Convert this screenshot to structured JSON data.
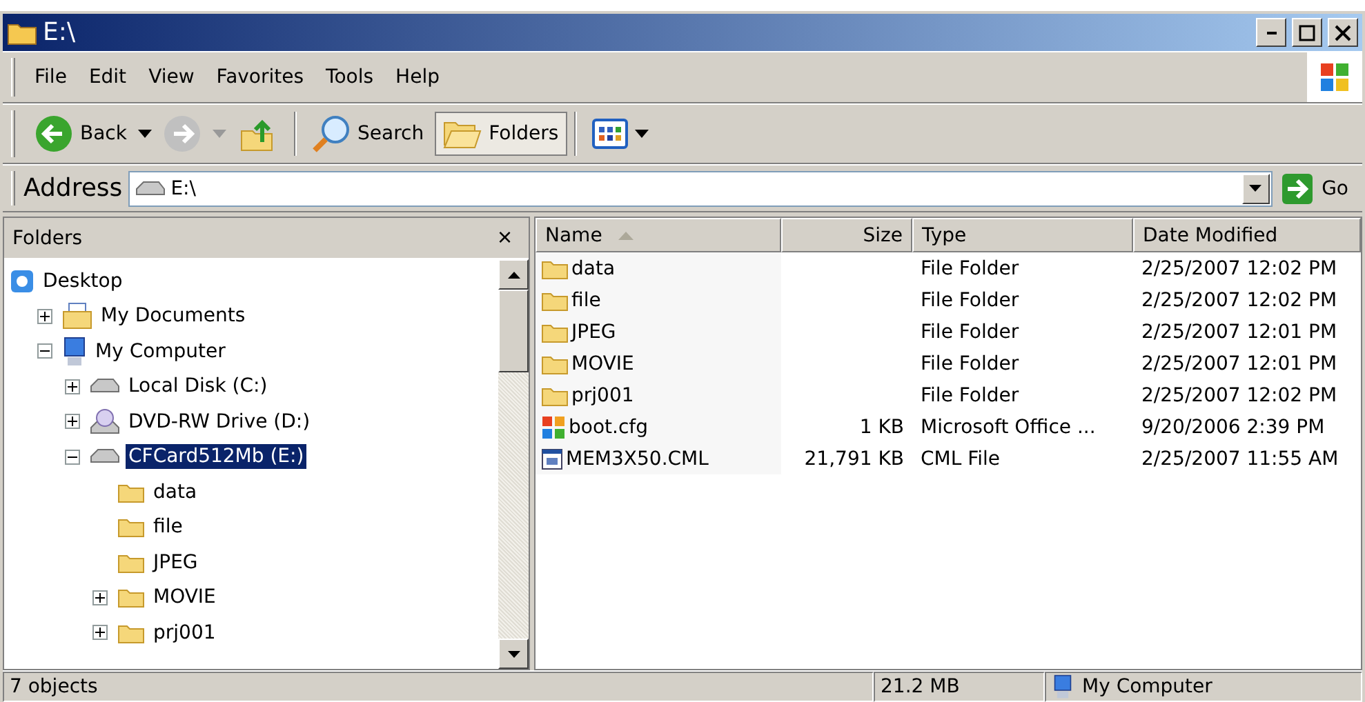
{
  "window": {
    "title": "E:\\"
  },
  "menu": [
    "File",
    "Edit",
    "View",
    "Favorites",
    "Tools",
    "Help"
  ],
  "toolbar": {
    "back": "Back",
    "search": "Search",
    "folders": "Folders",
    "folders_pressed": true
  },
  "address": {
    "label": "Address",
    "value": "E:\\",
    "go": "Go"
  },
  "folders_pane": {
    "title": "Folders",
    "close": "×",
    "tree": [
      {
        "label": "Desktop",
        "kind": "desktop",
        "selected": false,
        "children": [
          {
            "label": "My Documents",
            "kind": "documents",
            "expanded": false,
            "selected": false
          },
          {
            "label": "My Computer",
            "kind": "computer",
            "expanded": true,
            "selected": false,
            "children": [
              {
                "label": "Local Disk (C:)",
                "kind": "disk",
                "expanded": false,
                "selected": false
              },
              {
                "label": "DVD-RW Drive (D:)",
                "kind": "dvd",
                "expanded": false,
                "selected": false
              },
              {
                "label": "CFCard512Mb (E:)",
                "kind": "disk",
                "expanded": true,
                "selected": true,
                "children": [
                  {
                    "label": "data",
                    "kind": "folder",
                    "selected": false
                  },
                  {
                    "label": "file",
                    "kind": "folder",
                    "selected": false
                  },
                  {
                    "label": "JPEG",
                    "kind": "folder",
                    "selected": false
                  },
                  {
                    "label": "MOVIE",
                    "kind": "folder",
                    "expanded": false,
                    "selected": false
                  },
                  {
                    "label": "prj001",
                    "kind": "folder",
                    "expanded": false,
                    "selected": false
                  }
                ]
              }
            ]
          }
        ]
      }
    ]
  },
  "file_list": {
    "columns": [
      {
        "label": "Name",
        "sorted": true
      },
      {
        "label": "Size",
        "sorted": false
      },
      {
        "label": "Type",
        "sorted": false
      },
      {
        "label": "Date Modified",
        "sorted": false
      }
    ],
    "rows": [
      {
        "kind": "folder",
        "name": "data",
        "size": "",
        "type": "File Folder",
        "date": "2/25/2007 12:02 PM"
      },
      {
        "kind": "folder",
        "name": "file",
        "size": "",
        "type": "File Folder",
        "date": "2/25/2007 12:02 PM"
      },
      {
        "kind": "folder",
        "name": "JPEG",
        "size": "",
        "type": "File Folder",
        "date": "2/25/2007 12:01 PM"
      },
      {
        "kind": "folder",
        "name": "MOVIE",
        "size": "",
        "type": "File Folder",
        "date": "2/25/2007 12:01 PM"
      },
      {
        "kind": "folder",
        "name": "prj001",
        "size": "",
        "type": "File Folder",
        "date": "2/25/2007 12:02 PM"
      },
      {
        "kind": "office",
        "name": "boot.cfg",
        "size": "1 KB",
        "type": "Microsoft Office ...",
        "date": "9/20/2006 2:39 PM"
      },
      {
        "kind": "cml",
        "name": "MEM3X50.CML",
        "size": "21,791 KB",
        "type": "CML File",
        "date": "2/25/2007 11:55 AM"
      }
    ]
  },
  "status_bar": {
    "objects": "7 objects",
    "size": "21.2 MB",
    "zone": "My Computer"
  }
}
